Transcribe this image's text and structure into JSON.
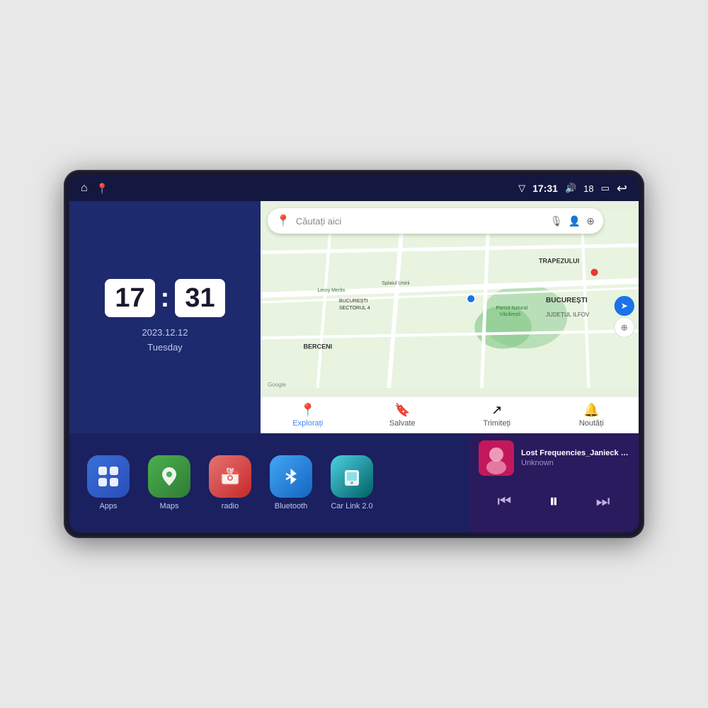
{
  "device": {
    "status_bar": {
      "left_icons": [
        "home",
        "maps"
      ],
      "time": "17:31",
      "signal": "▽",
      "volume": "🔊",
      "battery_level": "18",
      "battery_icon": "🔋",
      "back_icon": "↩"
    },
    "clock": {
      "hour": "17",
      "minute": "31",
      "date": "2023.12.12",
      "day": "Tuesday"
    },
    "map": {
      "search_placeholder": "Căutați aici",
      "nav_items": [
        {
          "label": "Explorați",
          "active": true
        },
        {
          "label": "Salvate",
          "active": false
        },
        {
          "label": "Trimiteți",
          "active": false
        },
        {
          "label": "Noutăți",
          "active": false
        }
      ],
      "labels": [
        "TRAPEZULUI",
        "BUCUREȘTI",
        "JUDEȚUL ILFOV",
        "BERCENI",
        "Parcul Natural Văcărești",
        "Leroy Merlin",
        "BUCUREȘTI\nSECTORUL 4",
        "Splaiul Unirii",
        "Google"
      ]
    },
    "apps": [
      {
        "id": "apps",
        "label": "Apps",
        "icon": "⊞",
        "bg": "icon-apps"
      },
      {
        "id": "maps",
        "label": "Maps",
        "icon": "📍",
        "bg": "icon-maps"
      },
      {
        "id": "radio",
        "label": "radio",
        "icon": "📻",
        "bg": "icon-radio"
      },
      {
        "id": "bluetooth",
        "label": "Bluetooth",
        "icon": "❄",
        "bg": "icon-bluetooth"
      },
      {
        "id": "carlink",
        "label": "Car Link 2.0",
        "icon": "📱",
        "bg": "icon-carlink"
      }
    ],
    "music": {
      "title": "Lost Frequencies_Janieck Devy-...",
      "artist": "Unknown",
      "controls": {
        "prev": "⏮",
        "play": "⏸",
        "next": "⏭"
      }
    }
  }
}
